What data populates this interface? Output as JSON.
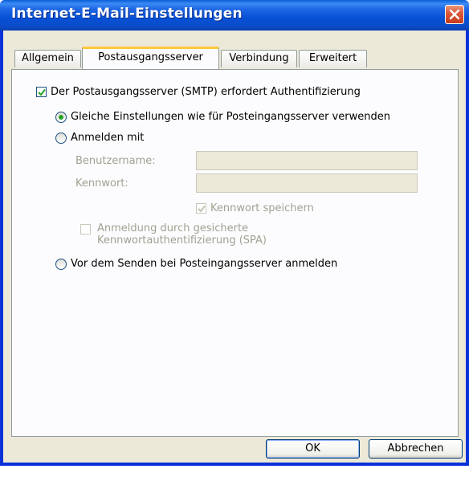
{
  "window": {
    "title": "Internet-E-Mail-Einstellungen"
  },
  "tabs": [
    {
      "label": "Allgemein",
      "active": false
    },
    {
      "label": "Postausgangsserver",
      "active": true
    },
    {
      "label": "Verbindung",
      "active": false
    },
    {
      "label": "Erweitert",
      "active": false
    }
  ],
  "outgoing": {
    "requires_auth": {
      "label": "Der Postausgangsserver (SMTP) erfordert Authentifizierung",
      "checked": true
    },
    "options": [
      {
        "label": "Gleiche Einstellungen wie für Posteingangsserver verwenden",
        "selected": true
      },
      {
        "label": "Anmelden mit",
        "selected": false
      },
      {
        "label": "Vor dem Senden bei Posteingangsserver anmelden",
        "selected": false
      }
    ],
    "username_label": "Benutzername:",
    "username_value": "",
    "password_label": "Kennwort:",
    "password_value": "",
    "remember_password": {
      "label": "Kennwort speichern",
      "checked": true,
      "enabled": false
    },
    "spa": {
      "label_line1": "Anmeldung durch gesicherte",
      "label_line2": "Kennwortauthentifizierung (SPA)",
      "checked": false,
      "enabled": false
    }
  },
  "buttons": {
    "ok": "OK",
    "cancel": "Abbrechen"
  },
  "colors": {
    "titlebar": "#0650d6",
    "frame": "#ece9d8",
    "active_tab_accent": "#ffc83c",
    "radio_dot": "#27a127"
  }
}
